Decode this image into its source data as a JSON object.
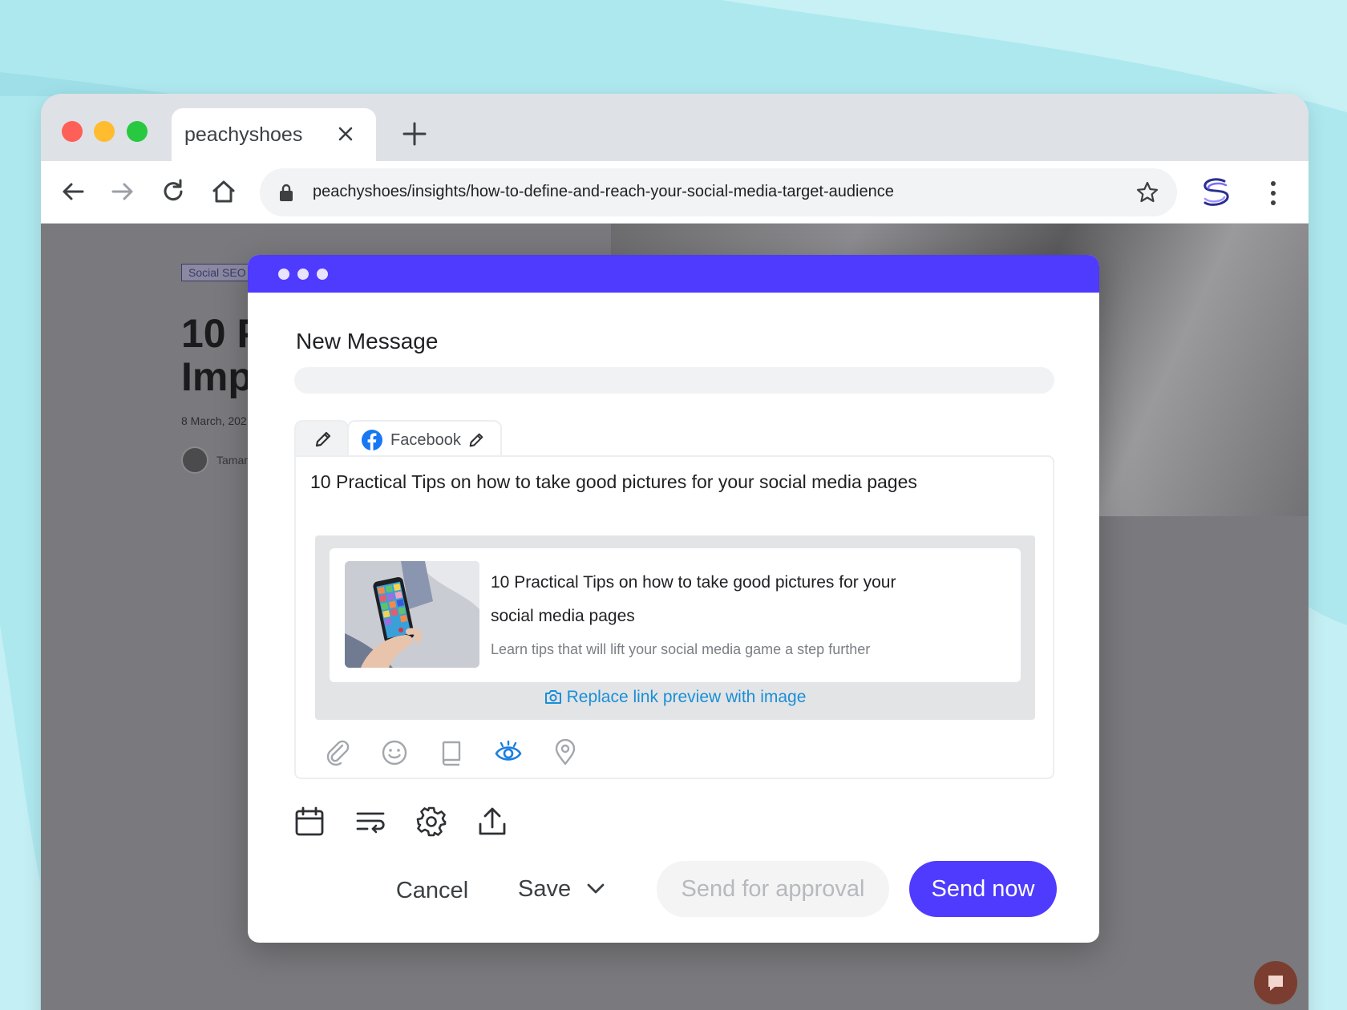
{
  "browser": {
    "tab_title": "peachyshoes",
    "url": "peachyshoes/insights/how-to-define-and-reach-your-social-media-target-audience"
  },
  "article": {
    "tag": "Social SEO",
    "title_fragment_line1": "10 P",
    "title_fragment_line2": "Imp",
    "date_fragment": "8 March, 202",
    "author_fragment": "Tamar"
  },
  "modal": {
    "title": "New Message",
    "network_tab_label": "Facebook",
    "post_text": "10 Practical Tips on how to take good pictures for your social media pages",
    "preview": {
      "title": "10 Practical Tips on how to take good pictures for your social media pages",
      "description": "Learn tips that will lift your social media game a step further",
      "replace_label": "Replace link preview with image"
    },
    "buttons": {
      "cancel": "Cancel",
      "save": "Save",
      "approval": "Send for approval",
      "send": "Send now"
    }
  },
  "colors": {
    "accent": "#4f3bfe",
    "link": "#1a8fd6",
    "facebook": "#1877f2"
  },
  "icons": [
    "back-arrow-icon",
    "forward-arrow-icon",
    "reload-icon",
    "home-icon",
    "lock-icon",
    "star-icon",
    "menu-dots-icon",
    "pencil-icon",
    "facebook-icon",
    "paperclip-icon",
    "emoji-icon",
    "book-icon",
    "eye-icon",
    "location-pin-icon",
    "calendar-icon",
    "text-format-icon",
    "gear-icon",
    "upload-icon",
    "camera-icon",
    "chevron-down-icon",
    "chat-icon"
  ]
}
